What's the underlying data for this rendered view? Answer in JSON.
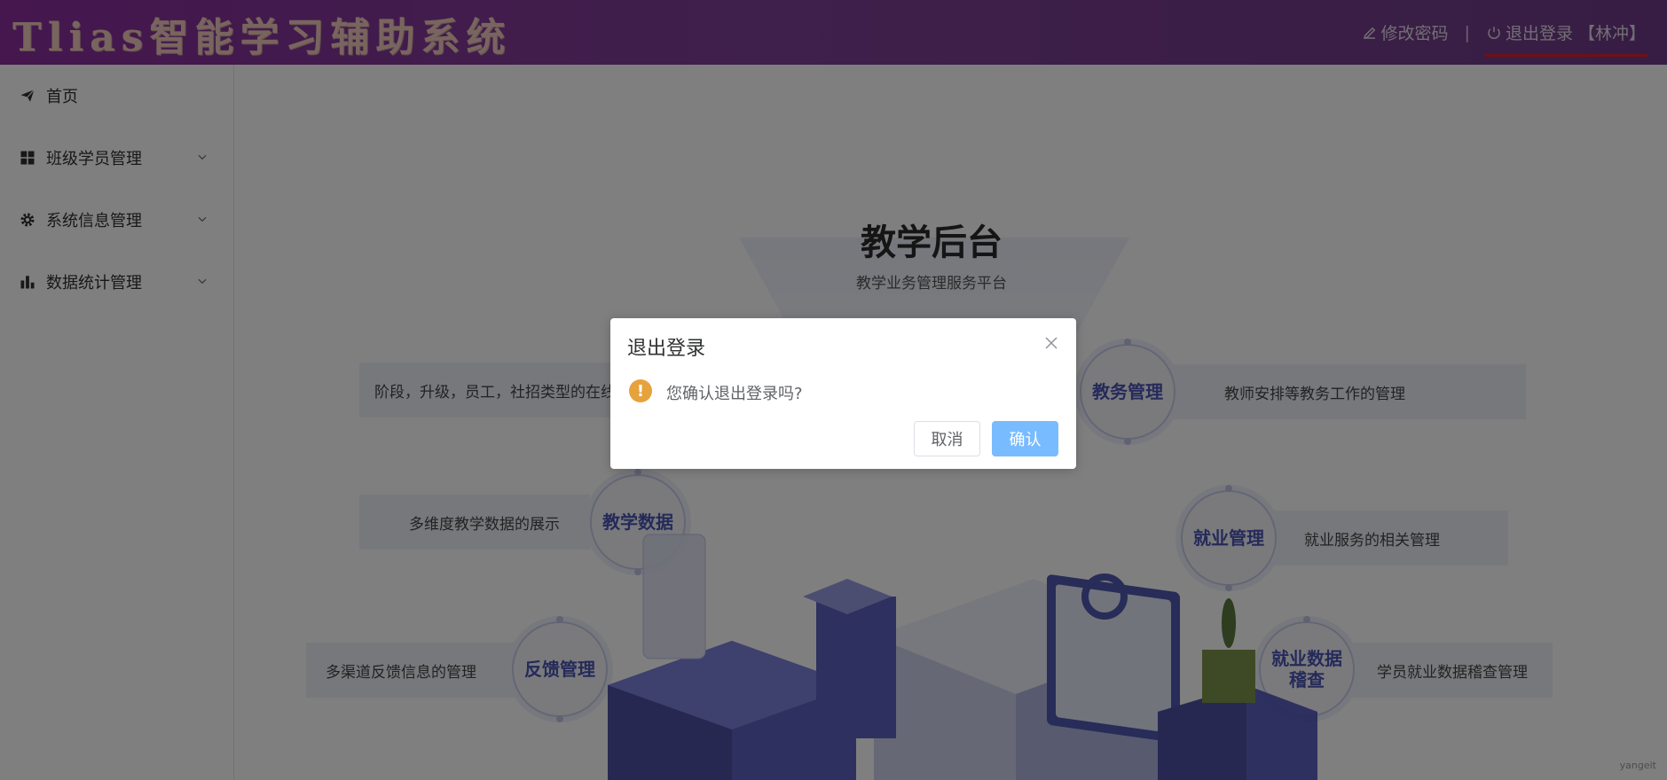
{
  "header": {
    "app_title": "Tlias智能学习辅助系统",
    "change_password_label": "修改密码",
    "separator": "|",
    "logout_label": "退出登录 【林冲】"
  },
  "sidebar": {
    "items": [
      {
        "label": "首页",
        "icon": "paper-plane-icon",
        "expandable": false
      },
      {
        "label": "班级学员管理",
        "icon": "grid-icon",
        "expandable": true
      },
      {
        "label": "系统信息管理",
        "icon": "gear-icon",
        "expandable": true
      },
      {
        "label": "数据统计管理",
        "icon": "bar-chart-icon",
        "expandable": true
      }
    ]
  },
  "main": {
    "hero_title": "教学后台",
    "hero_subtitle": "教学业务管理服务平台",
    "features": [
      {
        "title": "教务管理",
        "desc": "教师安排等教务工作的管理"
      },
      {
        "title": "教学数据",
        "desc": "多维度教学数据的展示"
      },
      {
        "title": "就业管理",
        "desc": "就业服务的相关管理"
      },
      {
        "title": "反馈管理",
        "desc": "多渠道反馈信息的管理"
      },
      {
        "title": "就业数据稽查",
        "title_line1": "就业数据",
        "title_line2": "稽查",
        "desc": "学员就业数据稽查管理"
      }
    ],
    "left_top_desc": "阶段，升级，员工，社招类型的在线",
    "watermark": "yangeit"
  },
  "dialog": {
    "title": "退出登录",
    "message": "您确认退出登录吗?",
    "cancel_label": "取消",
    "confirm_label": "确认",
    "warning_icon": "!"
  },
  "colors": {
    "header_gradient_start": "#8a2e9c",
    "header_gradient_end": "#6e3b86",
    "accent_confirm": "#79bbff",
    "warning": "#e6a23c",
    "logout_underline": "#e0202a"
  }
}
